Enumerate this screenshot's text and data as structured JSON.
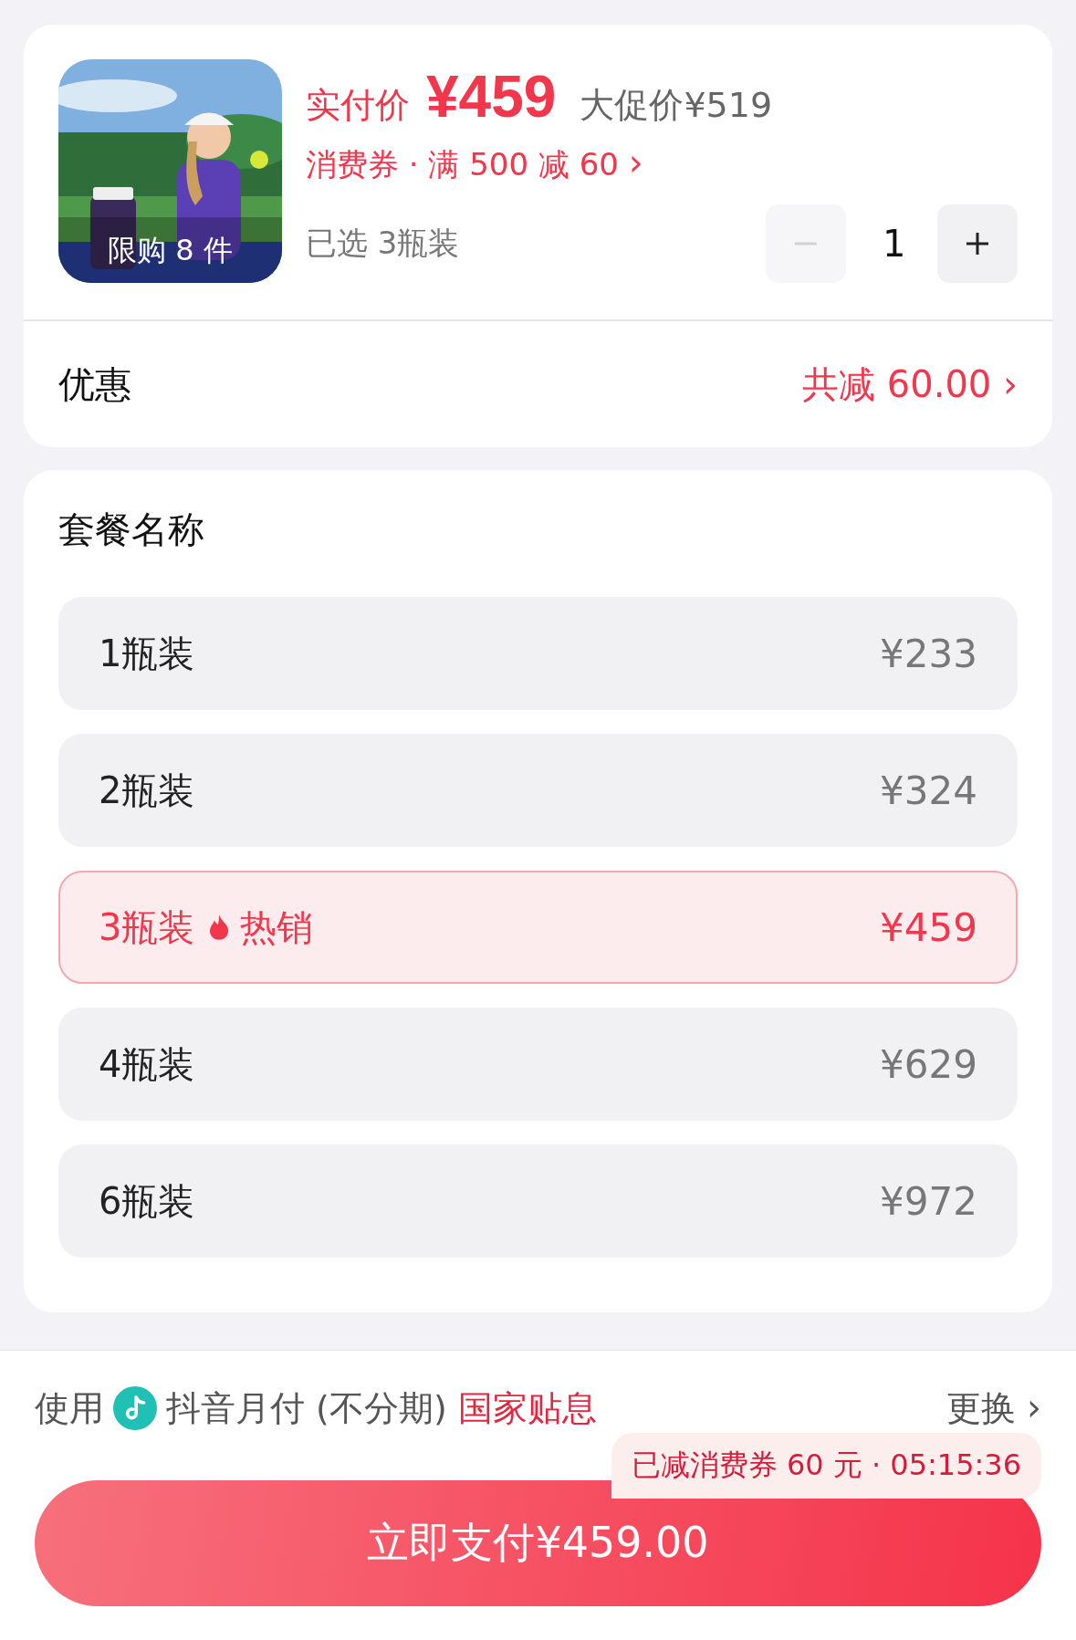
{
  "product": {
    "limit_badge": "限购 8 件",
    "price_label": "实付价",
    "price": "¥459",
    "promo_price": "大促价¥519",
    "coupon": "消费券 · 满 500 减 60",
    "coupon_arrow": "›",
    "selected_text": "已选 3瓶装",
    "quantity": "1",
    "minus_disabled": true,
    "plus_disabled": false
  },
  "discount": {
    "label": "优惠",
    "value": "共减 60.00",
    "arrow": "›"
  },
  "packages": {
    "title": "套餐名称",
    "options": [
      {
        "name": "1瓶装",
        "price": "¥233",
        "selected": false
      },
      {
        "name": "2瓶装",
        "price": "¥324",
        "selected": false
      },
      {
        "name": "3瓶装",
        "tag": "热销",
        "price": "¥459",
        "selected": true
      },
      {
        "name": "4瓶装",
        "price": "¥629",
        "selected": false
      },
      {
        "name": "6瓶装",
        "price": "¥972",
        "selected": false
      }
    ]
  },
  "payment": {
    "prefix": "使用",
    "method": "抖音月付 (不分期)",
    "highlight": "国家贴息",
    "change": "更换",
    "change_arrow": "›",
    "notice": "已减消费券 60 元 · 05:15:36",
    "pay_button": "立即支付¥459.00"
  }
}
